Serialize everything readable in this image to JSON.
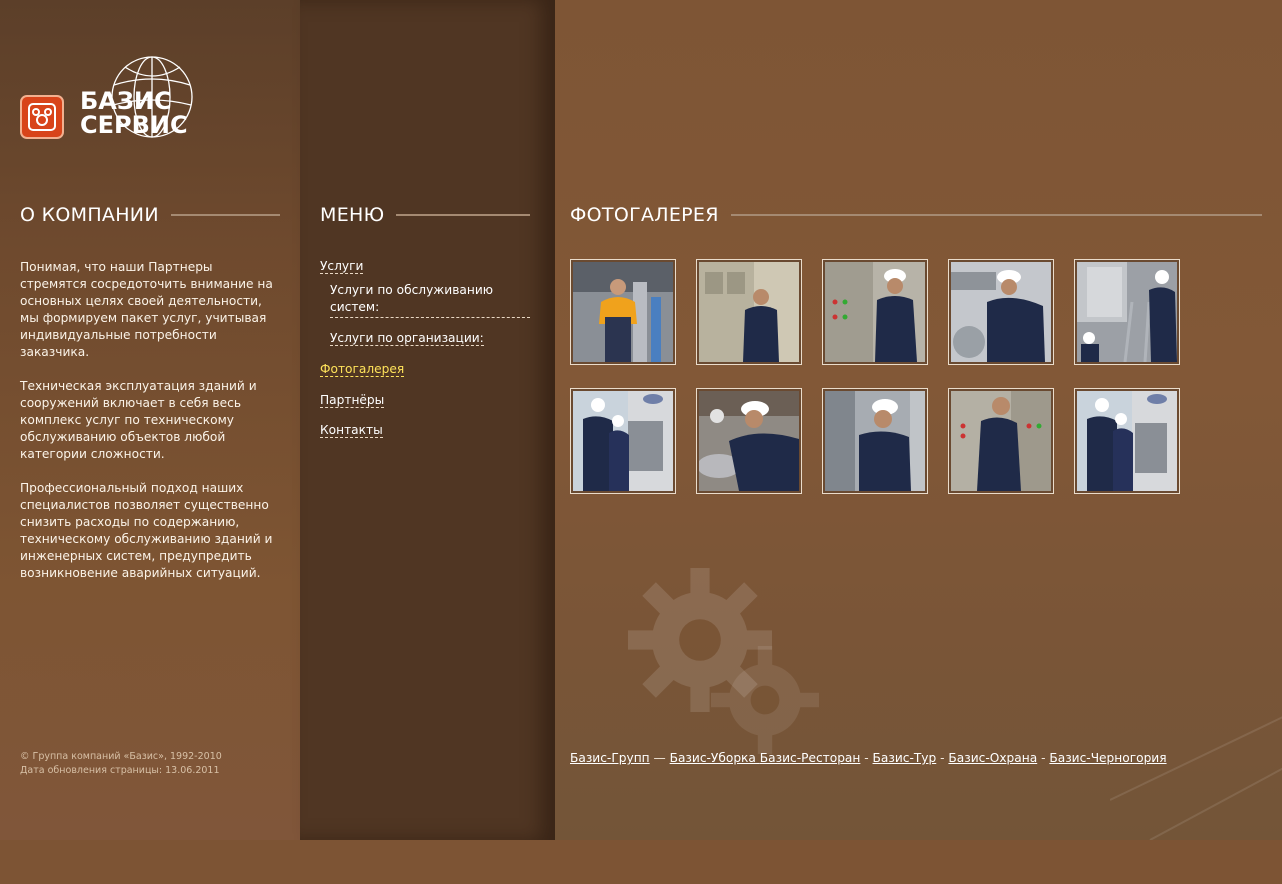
{
  "brand": {
    "line1": "БАЗИС",
    "line2": "СЕРВИС",
    "accent": "#d8441a"
  },
  "about": {
    "heading": "О КОМПАНИИ",
    "paragraphs": [
      "Понимая, что наши Партнеры  стремятся сосредоточить внимание на основных целях своей деятельности, мы формируем пакет услуг, учитывая индивидуальные потребности заказчика.",
      "Техническая эксплуатация зданий и сооружений включает в себя весь комплекс услуг по техническому обслуживанию объектов любой категории сложности.",
      "Профессиональный подход наших специалистов позволяет существенно снизить расходы по содержанию, техническому обслуживанию зданий и инженерных систем, предупредить возникновение аварийных ситуаций."
    ]
  },
  "footer": {
    "copyright": "© Группа компаний «Базис», 1992-2010",
    "updated": "Дата обновления страницы: 13.06.2011"
  },
  "menu": {
    "heading": "МЕНЮ",
    "items": [
      {
        "label": "Услуги",
        "active": false
      },
      {
        "label": "Услуги по обслуживанию систем:",
        "active": false
      },
      {
        "label": "Услуги по организации:",
        "active": false
      },
      {
        "label": "Фотогалерея",
        "active": true,
        "color": "#ffe35a"
      },
      {
        "label": "Партнёры",
        "active": false
      },
      {
        "label": "Контакты",
        "active": false
      }
    ]
  },
  "gallery": {
    "heading": "ФОТОГАЛЕРЕЯ",
    "photos": [
      {
        "subject": "worker-orange-shirt-pipes"
      },
      {
        "subject": "worker-electrical-cabinet"
      },
      {
        "subject": "worker-helmet-control-panel"
      },
      {
        "subject": "worker-helmet-machinery"
      },
      {
        "subject": "worker-ladder-ducts"
      },
      {
        "subject": "two-workers-carrier-unit"
      },
      {
        "subject": "worker-helmet-gauges"
      },
      {
        "subject": "worker-helmet-radio"
      },
      {
        "subject": "worker-switchboard"
      },
      {
        "subject": "two-workers-carrier-unit-2"
      }
    ]
  },
  "links": {
    "items": [
      "Базис-Групп",
      "Базис-Уборка ",
      "Базис-Ресторан",
      "Базис-Тур",
      "Базис-Охрана",
      "Базис-Черногория"
    ],
    "separators": [
      " — ",
      " ",
      " - ",
      " - ",
      " - "
    ]
  }
}
